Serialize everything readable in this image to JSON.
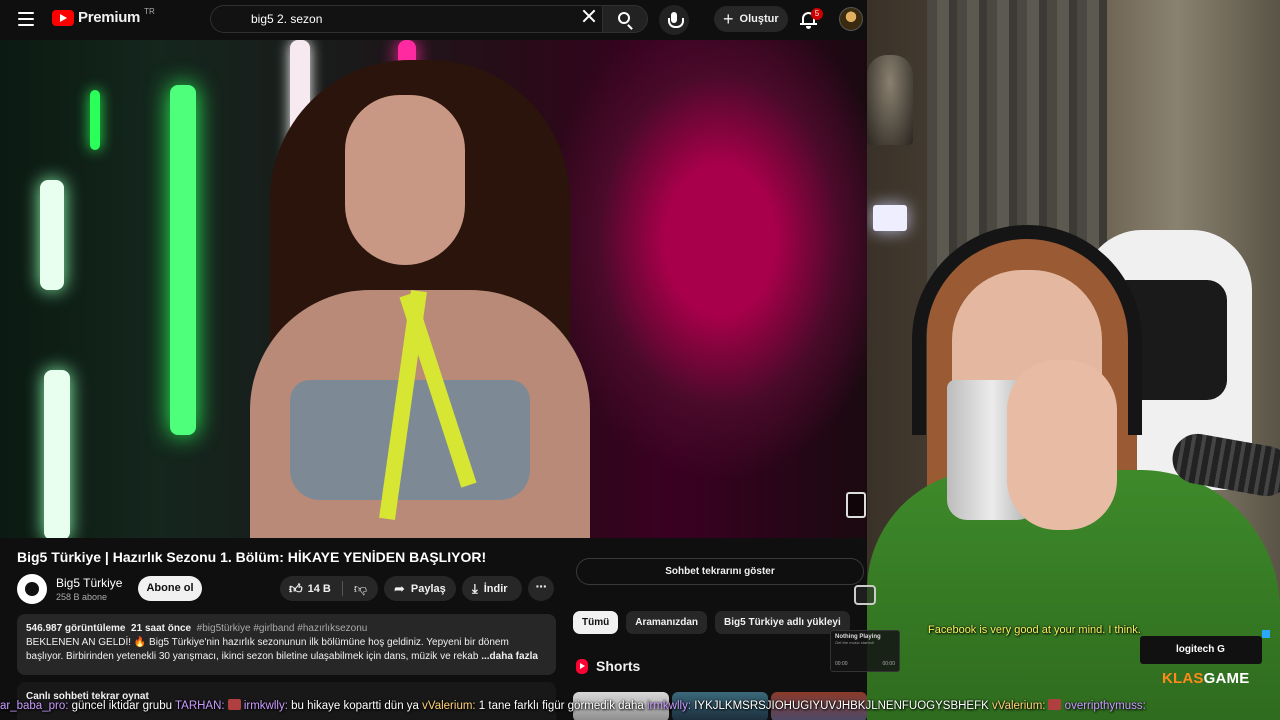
{
  "header": {
    "logo_brand": "Premium",
    "logo_region": "TR",
    "search_value": "big5 2. sezon",
    "create_label": "Oluştur",
    "notification_count": "5"
  },
  "video": {
    "title": "Big5 Türkiye | Hazırlık Sezonu 1. Bölüm: HİKAYE YENİDEN BAŞLIYOR!",
    "channel_name": "Big5 Türkiye",
    "subscribers": "258 B abone",
    "subscribe_label": "Abone ol",
    "likes": "14 B",
    "share_label": "Paylaş",
    "download_label": "İndir"
  },
  "description": {
    "views": "546.987 görüntüleme",
    "age": "21 saat önce",
    "hashtags": "#big5türkiye #girlband #hazırlıksezonu",
    "line1": "BEKLENEN AN GELDİ! 🔥 Big5 Türkiye'nin hazırlık sezonunun ilk bölümüne hoş geldiniz. Yepyeni bir dönem",
    "line2": "başlıyor. Birbirinden yetenekli 30 yarışmacı, ikinci sezon biletine ulaşabilmek için dans, müzik ve rekab",
    "more_label": "...daha fazla",
    "chat_replay_heading": "Canlı sohbeti tekrar oynat"
  },
  "sidebar": {
    "chat_replay_button": "Sohbet tekrarını göster",
    "chips": [
      "Tümü",
      "Aramanızdan",
      "Big5 Türkiye adlı yükleyi"
    ],
    "shorts_heading": "Shorts"
  },
  "stream": {
    "caption": "Facebook is very good at your mind. I think.",
    "sponsor": "logitech",
    "brand_part1": "KLAS",
    "brand_part2": "GAME"
  },
  "now_playing": {
    "title": "Nothing Playing",
    "subtitle": "Get the music started!",
    "time_start": "00:00",
    "time_end": "00:00"
  },
  "chat_ticker": [
    {
      "user": "ar_baba_pro:",
      "message": " güncel iktidar grubu "
    },
    {
      "user": "TARHAN:",
      "message": ""
    },
    {
      "user": "irmkwlly:",
      "message": " bu hikaye kopartti dün ya "
    },
    {
      "user": "vValerium:",
      "message": " 1 tane farklı figür görmedik daha "
    },
    {
      "user": "irmkwlly:",
      "message": " IYKJLKMSRSJIOHUGIYUVJHBKJLNENFUOGYSBHEFK "
    },
    {
      "user": "vValerium:",
      "message": ""
    },
    {
      "user": "overripthymuss:",
      "message": ""
    }
  ],
  "colors": {
    "accent_red": "#ff0000",
    "caption_yellow": "#f5f05a",
    "klas_orange": "#ff8a1a"
  }
}
